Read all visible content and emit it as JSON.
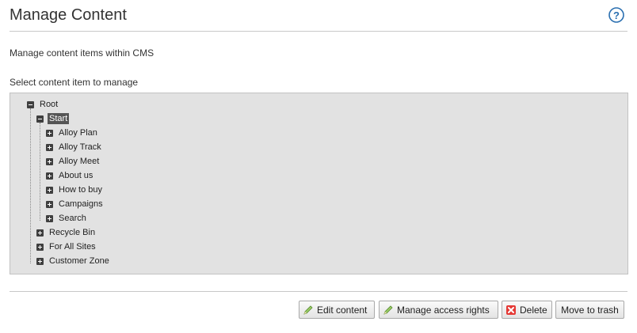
{
  "header": {
    "title": "Manage Content",
    "help_icon": "help-icon"
  },
  "description": "Manage content items within CMS",
  "select_label": "Select content item to manage",
  "tree": {
    "root": {
      "label": "Root",
      "expanded": true
    },
    "start": {
      "label": "Start",
      "expanded": true,
      "selected": true
    },
    "start_children": [
      {
        "label": "Alloy Plan",
        "expanded": false
      },
      {
        "label": "Alloy Track",
        "expanded": false
      },
      {
        "label": "Alloy Meet",
        "expanded": false
      },
      {
        "label": "About us",
        "expanded": false
      },
      {
        "label": "How to buy",
        "expanded": false
      },
      {
        "label": "Campaigns",
        "expanded": false
      },
      {
        "label": "Search",
        "expanded": false
      }
    ],
    "root_children": [
      {
        "label": "Recycle Bin",
        "expanded": false
      },
      {
        "label": "For All Sites",
        "expanded": false
      },
      {
        "label": "Customer Zone",
        "expanded": false
      }
    ]
  },
  "buttons": {
    "edit": {
      "label": "Edit content",
      "icon": "pencil-icon"
    },
    "access": {
      "label": "Manage access rights",
      "icon": "pencil-icon"
    },
    "delete": {
      "label": "Delete",
      "icon": "delete-x-icon"
    },
    "trash": {
      "label": "Move to trash"
    }
  },
  "colors": {
    "panel_bg": "#e2e2e2",
    "selected_bg": "#555555",
    "help_blue": "#2a6fb0",
    "delete_red": "#d23a2a",
    "pencil_green": "#7cb342"
  }
}
